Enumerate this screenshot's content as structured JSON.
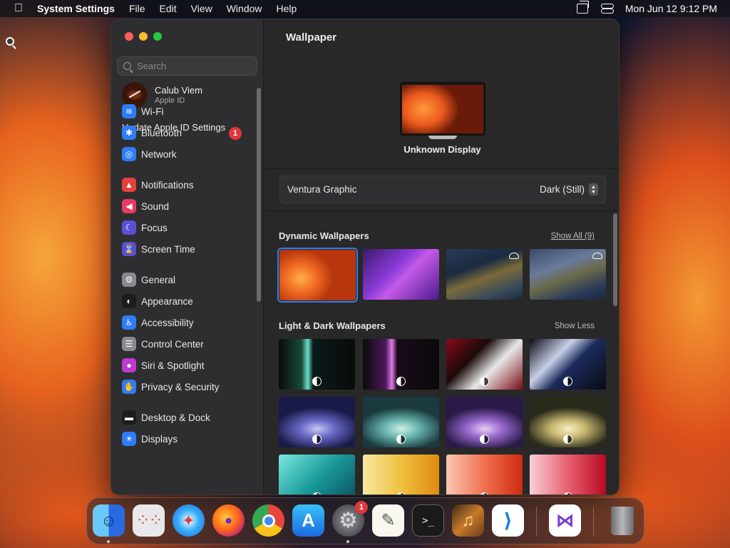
{
  "menubar": {
    "app_name": "System Settings",
    "menus": [
      "File",
      "Edit",
      "View",
      "Window",
      "Help"
    ],
    "datetime": "Mon Jun 12  9:12 PM"
  },
  "window": {
    "search_placeholder": "Search",
    "profile": {
      "name": "Calub Viem",
      "subtitle": "Apple ID"
    },
    "update_text": "Update Apple ID Settings",
    "update_badge": "1",
    "sidebar_items": [
      {
        "label": "Wi-Fi",
        "icon": "wifi-icon",
        "color": "#2f7cf6",
        "glyph": "≋"
      },
      {
        "label": "Bluetooth",
        "icon": "bluetooth-icon",
        "color": "#2f7cf6",
        "glyph": "✱"
      },
      {
        "label": "Network",
        "icon": "globe-icon",
        "color": "#2f7cf6",
        "glyph": "◎"
      },
      {
        "label": "Notifications",
        "icon": "bell-icon",
        "color": "#e8413c",
        "glyph": "▲"
      },
      {
        "label": "Sound",
        "icon": "speaker-icon",
        "color": "#e83c62",
        "glyph": "◀"
      },
      {
        "label": "Focus",
        "icon": "moon-icon",
        "color": "#5b4fd6",
        "glyph": "☾"
      },
      {
        "label": "Screen Time",
        "icon": "hourglass-icon",
        "color": "#5b4fd6",
        "glyph": "⌛"
      },
      {
        "label": "General",
        "icon": "gear-icon",
        "color": "#8a8a8e",
        "glyph": "⚙"
      },
      {
        "label": "Appearance",
        "icon": "appearance-icon",
        "color": "#1c1c1c",
        "glyph": "◐"
      },
      {
        "label": "Accessibility",
        "icon": "accessibility-icon",
        "color": "#2f7cf6",
        "glyph": "♿"
      },
      {
        "label": "Control Center",
        "icon": "control-center-icon",
        "color": "#8a8a8e",
        "glyph": "☰"
      },
      {
        "label": "Siri & Spotlight",
        "icon": "siri-icon",
        "color": "#c03ad0",
        "glyph": "●"
      },
      {
        "label": "Privacy & Security",
        "icon": "hand-icon",
        "color": "#2f7cf6",
        "glyph": "✋"
      },
      {
        "label": "Desktop & Dock",
        "icon": "dock-icon",
        "color": "#1c1c1c",
        "glyph": "▬"
      },
      {
        "label": "Displays",
        "icon": "sun-icon",
        "color": "#2f7cf6",
        "glyph": "☀"
      }
    ],
    "content": {
      "title": "Wallpaper",
      "display_name": "Unknown Display",
      "current_wallpaper": "Ventura Graphic",
      "appearance_value": "Dark (Still)",
      "dynamic_section": {
        "title": "Dynamic Wallpapers",
        "link": "Show All (9)"
      },
      "lightdark_section": {
        "title": "Light & Dark Wallpapers",
        "link": "Show Less"
      }
    }
  },
  "dock": {
    "apps": [
      "Finder",
      "Launchpad",
      "Safari",
      "Firefox",
      "Chrome",
      "App Store",
      "System Settings",
      "TextEdit",
      "Terminal",
      "GarageBand",
      "Visual Studio Code",
      "Visual Studio",
      "Trash"
    ],
    "settings_badge": "1"
  }
}
